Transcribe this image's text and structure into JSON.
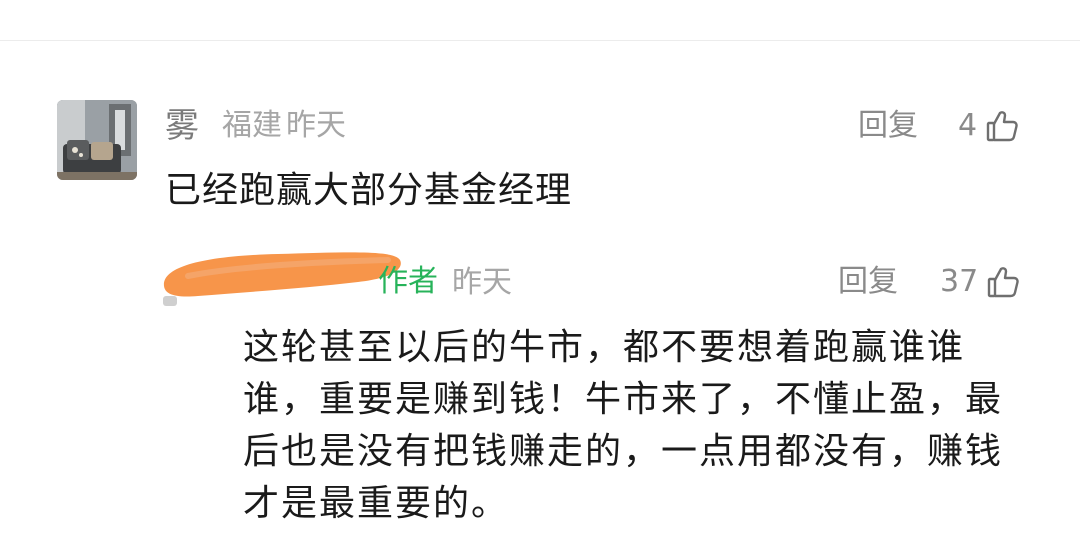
{
  "comment": {
    "username": "雾",
    "location": "福建",
    "time": "昨天",
    "reply_label": "回复",
    "likes": "4",
    "like_icon": "thumbs-up-icon",
    "text": "已经跑赢大部分基金经理"
  },
  "reply": {
    "username": "",
    "author_badge": "作者",
    "time": "昨天",
    "reply_label": "回复",
    "likes": "37",
    "like_icon": "thumbs-up-icon",
    "text": "这轮甚至以后的牛市，都不要想着跑赢谁谁谁，重要是赚到钱！牛市来了，不懂止盈，最后也是没有把钱赚走的，一点用都没有，赚钱才是最重要的。"
  },
  "colors": {
    "author_badge": "#27b35a",
    "redaction": "#f7954a",
    "muted_text": "#a6a6a6",
    "primary_text": "#1a1a1a"
  }
}
